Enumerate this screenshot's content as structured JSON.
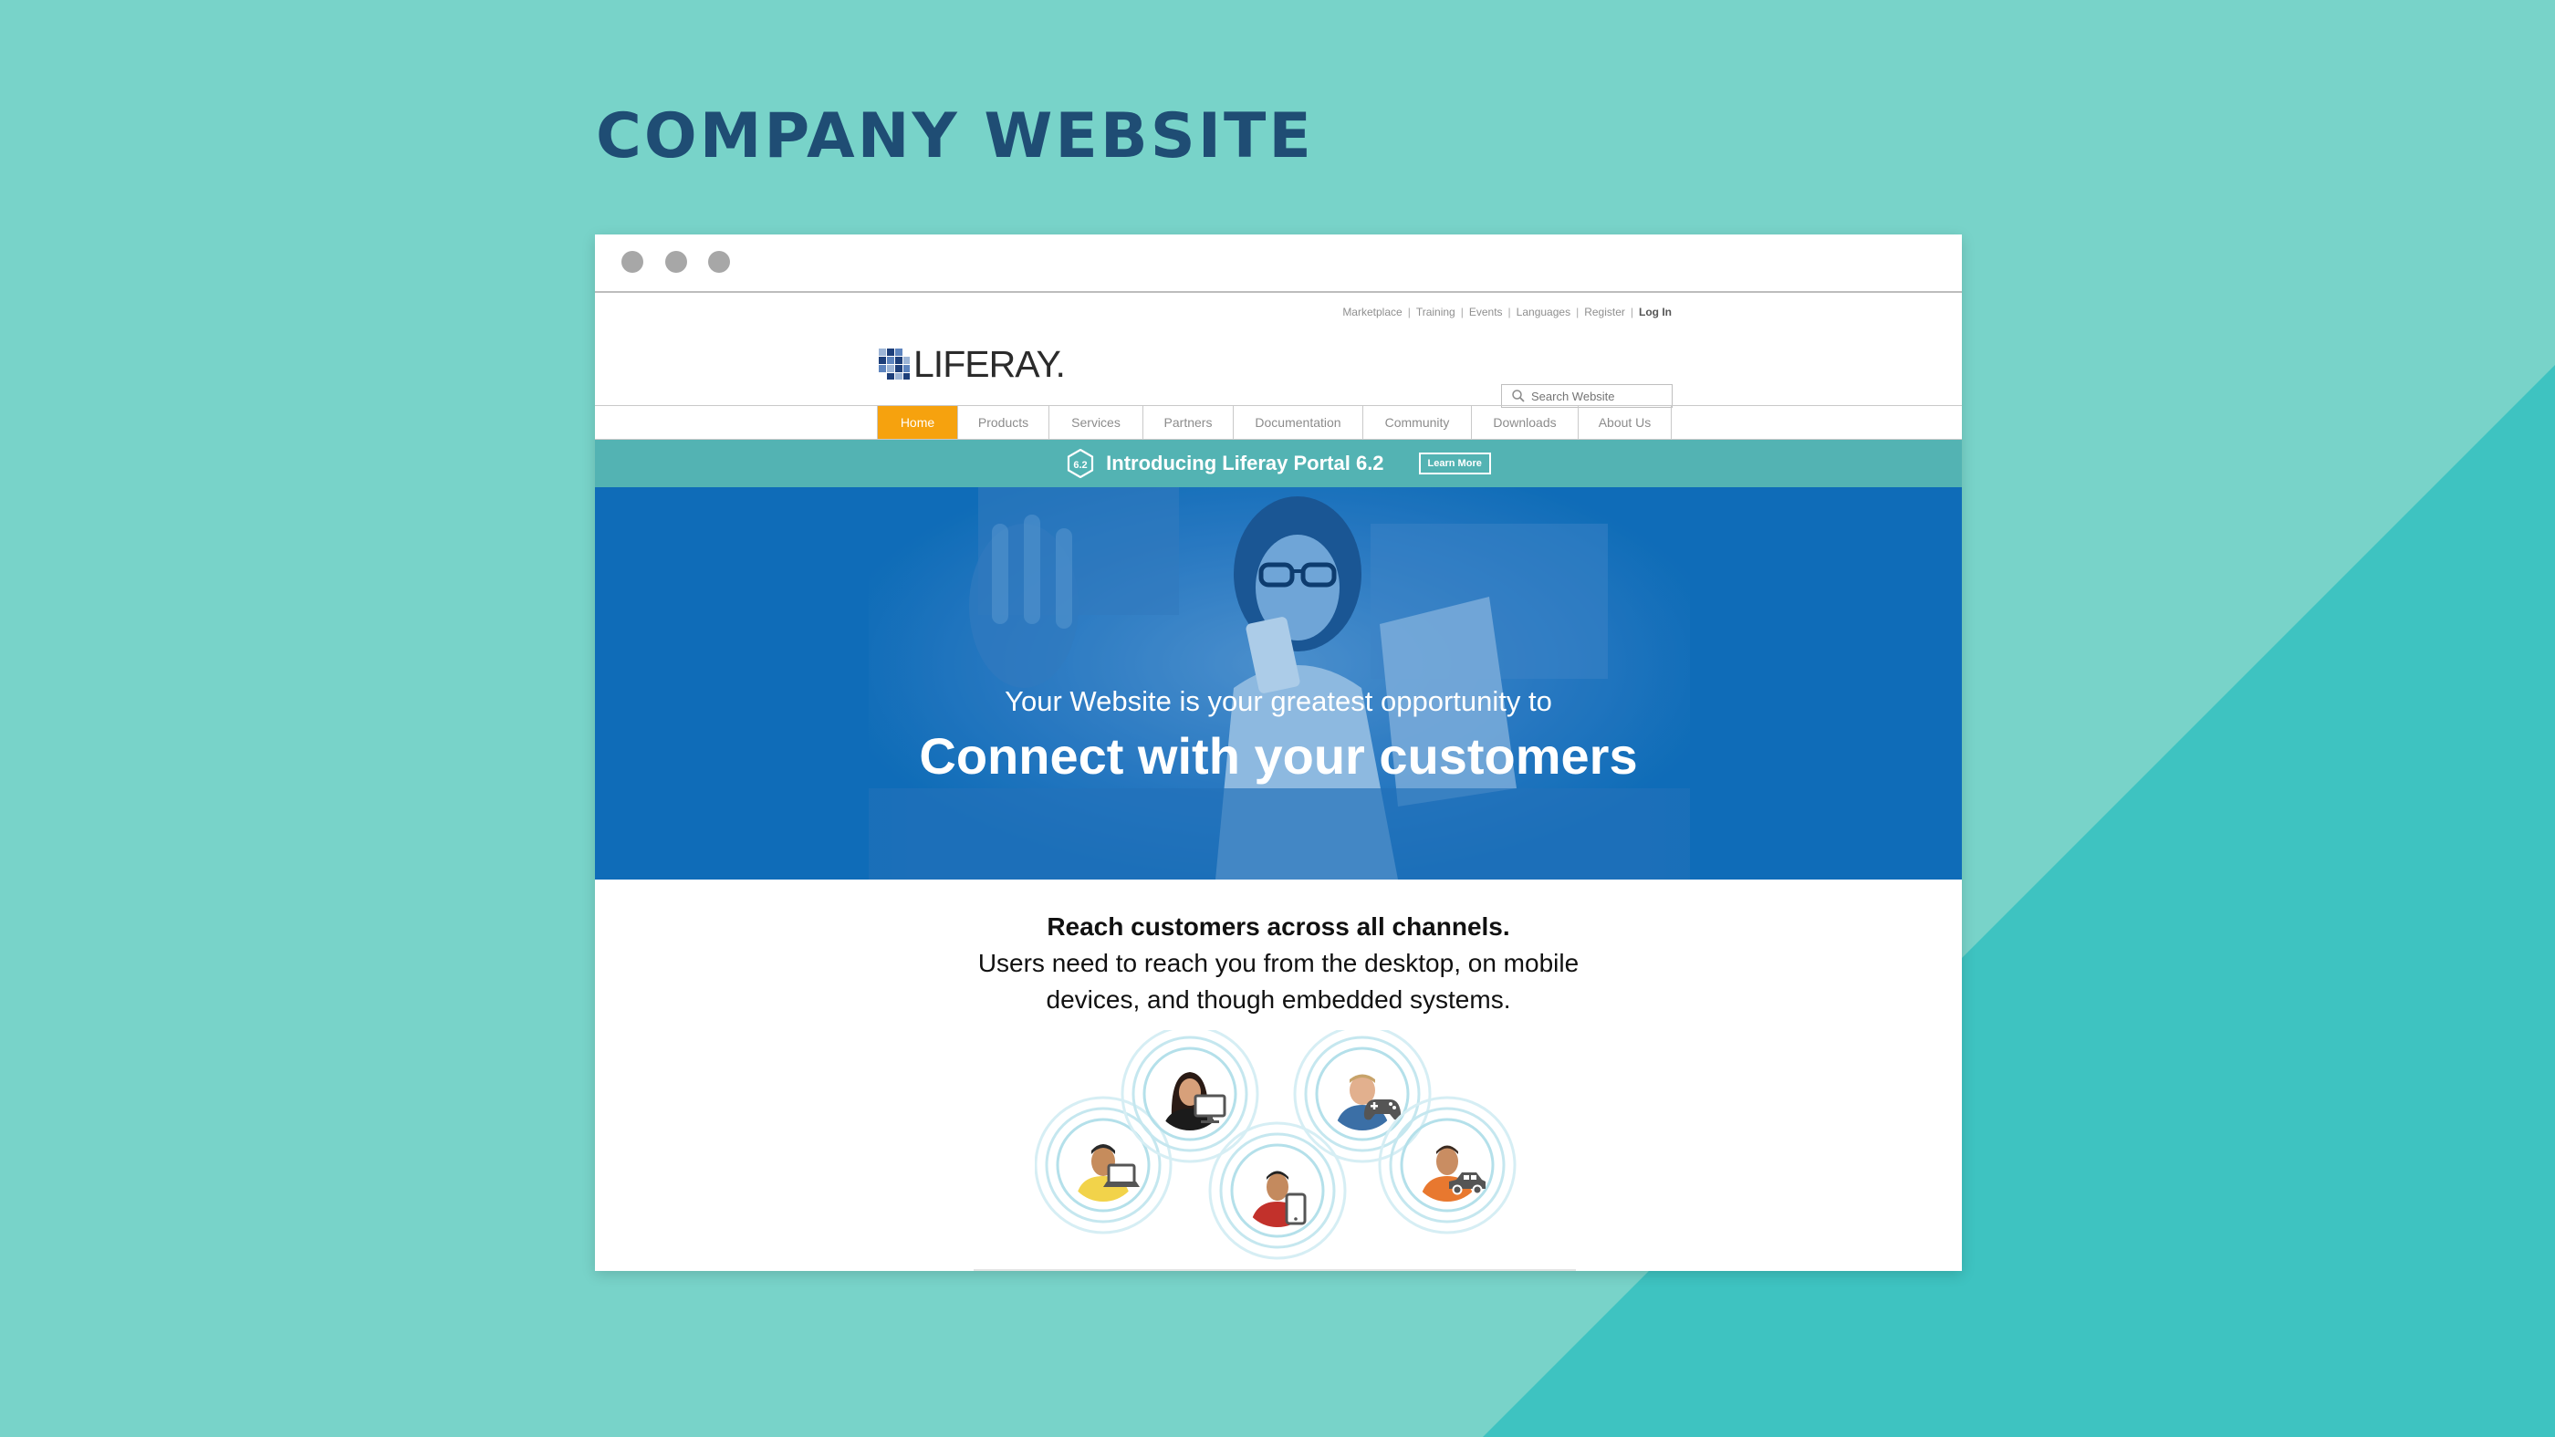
{
  "slide": {
    "title": "COMPANY WEBSITE"
  },
  "colors": {
    "background": "#78d3c9",
    "background_diagonal": "#3ec3c1",
    "title": "#1f4d74",
    "nav_active": "#f6a20e",
    "announce_bar": "#53b3b3",
    "hero_blue": "#0f6db8"
  },
  "site": {
    "toplinks": {
      "marketplace": "Marketplace",
      "training": "Training",
      "events": "Events",
      "languages": "Languages",
      "register": "Register",
      "login": "Log In"
    },
    "logo_text": "LIFERAY.",
    "search": {
      "placeholder": "Search Website"
    },
    "nav": {
      "home": "Home",
      "products": "Products",
      "services": "Services",
      "partners": "Partners",
      "documentation": "Documentation",
      "community": "Community",
      "downloads": "Downloads",
      "about": "About Us",
      "active": "Home"
    },
    "announcement": {
      "badge": "6.2",
      "text": "Introducing Liferay Portal 6.2",
      "button": "Learn More"
    },
    "hero": {
      "subtitle": "Your Website is your greatest opportunity to",
      "title": "Connect with your customers"
    },
    "reach": {
      "title": "Reach customers across all channels.",
      "line1": "Users need to reach you from the desktop, on mobile",
      "line2": "devices, and though embedded systems."
    },
    "channels": {
      "icons": [
        "monitor-icon",
        "gamepad-icon",
        "laptop-icon",
        "tablet-icon",
        "car-icon"
      ]
    }
  }
}
